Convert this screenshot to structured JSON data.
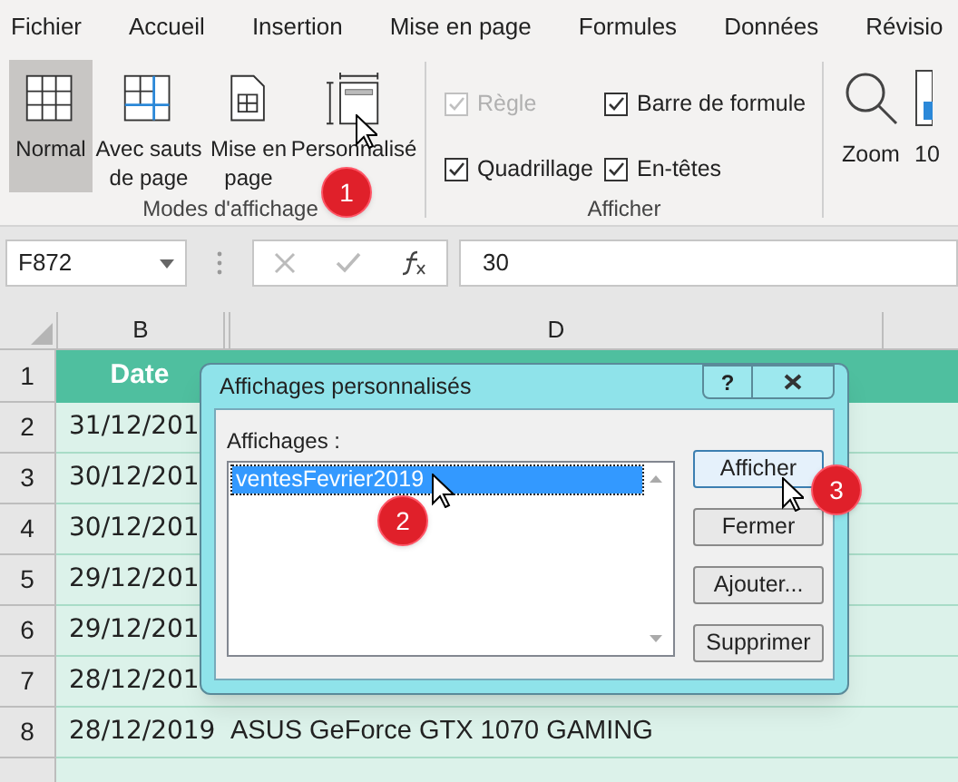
{
  "menu_tabs": [
    {
      "label": "Fichier",
      "selected": false
    },
    {
      "label": "Accueil",
      "selected": false
    },
    {
      "label": "Insertion",
      "selected": false
    },
    {
      "label": "Mise en page",
      "selected": false
    },
    {
      "label": "Formules",
      "selected": false
    },
    {
      "label": "Données",
      "selected": false
    },
    {
      "label": "Révisio",
      "selected": false
    }
  ],
  "ribbon": {
    "view_modes": {
      "label": "Modes d'affichage",
      "items": [
        {
          "kind": "normal",
          "label": "Normal",
          "selected": true
        },
        {
          "kind": "breaks",
          "label": "Avec sauts de page",
          "selected": false
        },
        {
          "kind": "page",
          "label": "Mise en page",
          "selected": false
        },
        {
          "kind": "custom",
          "label": "Personnalisé",
          "selected": false
        }
      ]
    },
    "show": {
      "label": "Afficher",
      "items": [
        {
          "label": "Règle",
          "checked": true,
          "disabled": true
        },
        {
          "label": "Quadrillage",
          "checked": true,
          "disabled": false
        },
        {
          "label": "Barre de formule",
          "checked": true,
          "disabled": false
        },
        {
          "label": "En-têtes",
          "checked": true,
          "disabled": false
        }
      ]
    },
    "zoom": {
      "label": "Zoom",
      "next_label": "10"
    }
  },
  "formula_bar": {
    "name_box": "F872",
    "formula": "30"
  },
  "columns": [
    "B",
    "D"
  ],
  "rows": [
    {
      "number": "1",
      "kind": "header",
      "date": "Date"
    },
    {
      "number": "2",
      "kind": "data",
      "date": "31/12/201"
    },
    {
      "number": "3",
      "kind": "data",
      "date": "30/12/201"
    },
    {
      "number": "4",
      "kind": "data",
      "date": "30/12/201"
    },
    {
      "number": "5",
      "kind": "data",
      "date": "29/12/201"
    },
    {
      "number": "6",
      "kind": "data",
      "date": "29/12/201"
    },
    {
      "number": "7",
      "kind": "data",
      "date": "28/12/201"
    },
    {
      "number": "8",
      "kind": "data",
      "date": "28/12/2019",
      "product": "ASUS GeForce GTX 1070 GAMING"
    }
  ],
  "dialog": {
    "title": "Affichages personnalisés",
    "help": "?",
    "list_label": "Affichages :",
    "views": [
      {
        "label": "ventesFevrier2019",
        "selected": true
      }
    ],
    "buttons": [
      {
        "label": "Afficher",
        "default": true
      },
      {
        "label": "Fermer",
        "default": false
      },
      {
        "label": "Ajouter...",
        "default": false
      },
      {
        "label": "Supprimer",
        "default": false
      }
    ]
  },
  "step_badges": [
    "1",
    "2",
    "3"
  ]
}
